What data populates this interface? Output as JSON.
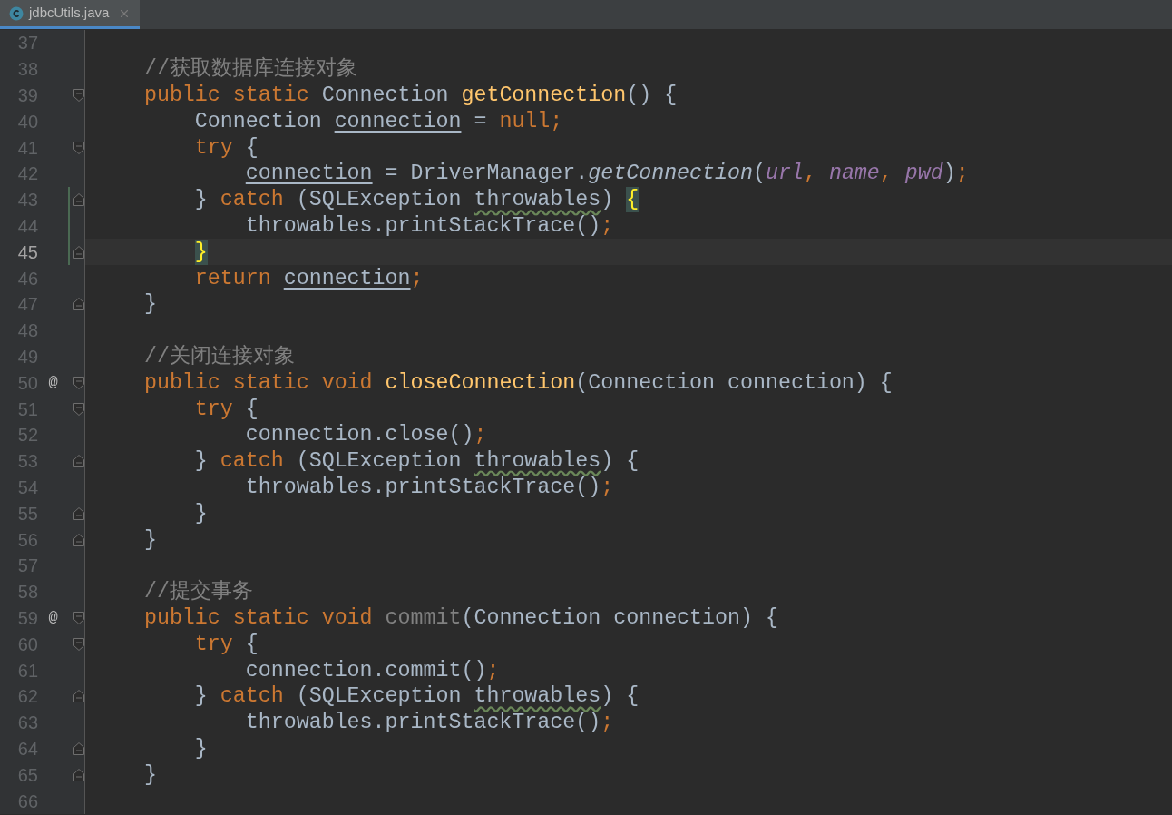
{
  "tabs": [
    {
      "label": "jdbcUtils.java",
      "selected": true
    }
  ],
  "lines": [
    {
      "number": "37",
      "current": false,
      "fold_start": false,
      "fold_end": false,
      "scope": false
    },
    {
      "number": "38",
      "current": false,
      "fold_start": false,
      "fold_end": false,
      "scope": false,
      "tokens": [
        {
          "kind": "comment",
          "text": "    //获取数据库连接对象"
        }
      ]
    },
    {
      "number": "39",
      "current": false,
      "fold_start": true,
      "fold_end": false,
      "scope": false,
      "tokens": [
        {
          "kind": "kw",
          "text": "    public static "
        },
        {
          "kind": "plain",
          "text": "Connection "
        },
        {
          "kind": "method",
          "text": "getConnection"
        },
        {
          "kind": "plain",
          "text": "() {"
        }
      ]
    },
    {
      "number": "40",
      "current": false,
      "fold_start": false,
      "fold_end": false,
      "scope": false,
      "tokens": [
        {
          "kind": "plain",
          "text": "        Connection "
        },
        {
          "kind": "var",
          "text": "connection"
        },
        {
          "kind": "plain",
          "text": " = "
        },
        {
          "kind": "kw",
          "text": "null;"
        }
      ]
    },
    {
      "number": "41",
      "current": false,
      "fold_start": true,
      "fold_end": false,
      "scope": false,
      "tokens": [
        {
          "kind": "kw",
          "text": "        try "
        },
        {
          "kind": "plain",
          "text": "{"
        }
      ]
    },
    {
      "number": "42",
      "current": false,
      "fold_start": false,
      "fold_end": false,
      "scope": false,
      "tokens": [
        {
          "kind": "var",
          "text": "            connection"
        },
        {
          "kind": "plain",
          "text": " = DriverManager."
        },
        {
          "kind": "italic",
          "text": "getConnection"
        },
        {
          "kind": "plain",
          "text": "("
        },
        {
          "kind": "field",
          "text": "url"
        },
        {
          "kind": "kw",
          "text": ", "
        },
        {
          "kind": "field",
          "text": "name"
        },
        {
          "kind": "kw",
          "text": ", "
        },
        {
          "kind": "field",
          "text": "pwd"
        },
        {
          "kind": "plain",
          "text": ")"
        },
        {
          "kind": "kw",
          "text": ";"
        }
      ]
    },
    {
      "number": "43",
      "current": false,
      "fold_start": false,
      "fold_end": true,
      "scope": true,
      "tokens": [
        {
          "kind": "plain",
          "text": "        } "
        },
        {
          "kind": "kw",
          "text": "catch "
        },
        {
          "kind": "plain",
          "text": "(SQLException "
        },
        {
          "kind": "typo",
          "text": "throwables"
        },
        {
          "kind": "plain",
          "text": ") "
        },
        {
          "kind": "brace",
          "text": "{"
        }
      ]
    },
    {
      "number": "44",
      "current": false,
      "fold_start": false,
      "fold_end": false,
      "scope": true,
      "tokens": [
        {
          "kind": "plain",
          "text": "            throwables.printStackTrace()"
        },
        {
          "kind": "kw",
          "text": ";"
        }
      ]
    },
    {
      "number": "45",
      "current": true,
      "fold_start": false,
      "fold_end": true,
      "scope": true,
      "tokens": [
        {
          "kind": "brace",
          "text": "        }"
        }
      ]
    },
    {
      "number": "46",
      "current": false,
      "fold_start": false,
      "fold_end": false,
      "scope": false,
      "tokens": [
        {
          "kind": "kw",
          "text": "        return "
        },
        {
          "kind": "var",
          "text": "connection"
        },
        {
          "kind": "kw",
          "text": ";"
        }
      ]
    },
    {
      "number": "47",
      "current": false,
      "fold_start": false,
      "fold_end": true,
      "scope": false,
      "tokens": [
        {
          "kind": "plain",
          "text": "    }"
        }
      ]
    },
    {
      "number": "48",
      "current": false,
      "fold_start": false,
      "fold_end": false,
      "scope": false
    },
    {
      "number": "49",
      "current": false,
      "fold_start": false,
      "fold_end": false,
      "scope": false,
      "tokens": [
        {
          "kind": "comment",
          "text": "    //关闭连接对象"
        }
      ]
    },
    {
      "number": "50",
      "current": false,
      "marker": "@",
      "fold_start": true,
      "fold_end": false,
      "scope": false,
      "tokens": [
        {
          "kind": "kw",
          "text": "    public static void "
        },
        {
          "kind": "method",
          "text": "closeConnection"
        },
        {
          "kind": "plain",
          "text": "(Connection connection) {"
        }
      ]
    },
    {
      "number": "51",
      "current": false,
      "fold_start": true,
      "fold_end": false,
      "scope": false,
      "tokens": [
        {
          "kind": "kw",
          "text": "        try "
        },
        {
          "kind": "plain",
          "text": "{"
        }
      ]
    },
    {
      "number": "52",
      "current": false,
      "fold_start": false,
      "fold_end": false,
      "scope": false,
      "tokens": [
        {
          "kind": "plain",
          "text": "            connection.close()"
        },
        {
          "kind": "kw",
          "text": ";"
        }
      ]
    },
    {
      "number": "53",
      "current": false,
      "fold_start": false,
      "fold_end": true,
      "scope": false,
      "tokens": [
        {
          "kind": "plain",
          "text": "        } "
        },
        {
          "kind": "kw",
          "text": "catch "
        },
        {
          "kind": "plain",
          "text": "(SQLException "
        },
        {
          "kind": "typo",
          "text": "throwables"
        },
        {
          "kind": "plain",
          "text": ") {"
        }
      ]
    },
    {
      "number": "54",
      "current": false,
      "fold_start": false,
      "fold_end": false,
      "scope": false,
      "tokens": [
        {
          "kind": "plain",
          "text": "            throwables.printStackTrace()"
        },
        {
          "kind": "kw",
          "text": ";"
        }
      ]
    },
    {
      "number": "55",
      "current": false,
      "fold_start": false,
      "fold_end": true,
      "scope": false,
      "tokens": [
        {
          "kind": "plain",
          "text": "        }"
        }
      ]
    },
    {
      "number": "56",
      "current": false,
      "fold_start": false,
      "fold_end": true,
      "scope": false,
      "tokens": [
        {
          "kind": "plain",
          "text": "    }"
        }
      ]
    },
    {
      "number": "57",
      "current": false,
      "fold_start": false,
      "fold_end": false,
      "scope": false
    },
    {
      "number": "58",
      "current": false,
      "fold_start": false,
      "fold_end": false,
      "scope": false,
      "tokens": [
        {
          "kind": "comment",
          "text": "    //提交事务"
        }
      ]
    },
    {
      "number": "59",
      "current": false,
      "marker": "@",
      "fold_start": true,
      "fold_end": false,
      "scope": false,
      "tokens": [
        {
          "kind": "kw",
          "text": "    public static void "
        },
        {
          "kind": "unused",
          "text": "commit"
        },
        {
          "kind": "plain",
          "text": "(Connection connection) {"
        }
      ]
    },
    {
      "number": "60",
      "current": false,
      "fold_start": true,
      "fold_end": false,
      "scope": false,
      "tokens": [
        {
          "kind": "kw",
          "text": "        try "
        },
        {
          "kind": "plain",
          "text": "{"
        }
      ]
    },
    {
      "number": "61",
      "current": false,
      "fold_start": false,
      "fold_end": false,
      "scope": false,
      "tokens": [
        {
          "kind": "plain",
          "text": "            connection.commit()"
        },
        {
          "kind": "kw",
          "text": ";"
        }
      ]
    },
    {
      "number": "62",
      "current": false,
      "fold_start": false,
      "fold_end": true,
      "scope": false,
      "tokens": [
        {
          "kind": "plain",
          "text": "        } "
        },
        {
          "kind": "kw",
          "text": "catch "
        },
        {
          "kind": "plain",
          "text": "(SQLException "
        },
        {
          "kind": "typo",
          "text": "throwables"
        },
        {
          "kind": "plain",
          "text": ") {"
        }
      ]
    },
    {
      "number": "63",
      "current": false,
      "fold_start": false,
      "fold_end": false,
      "scope": false,
      "tokens": [
        {
          "kind": "plain",
          "text": "            throwables.printStackTrace()"
        },
        {
          "kind": "kw",
          "text": ";"
        }
      ]
    },
    {
      "number": "64",
      "current": false,
      "fold_start": false,
      "fold_end": true,
      "scope": false,
      "tokens": [
        {
          "kind": "plain",
          "text": "        }"
        }
      ]
    },
    {
      "number": "65",
      "current": false,
      "fold_start": false,
      "fold_end": true,
      "scope": false,
      "tokens": [
        {
          "kind": "plain",
          "text": "    }"
        }
      ]
    },
    {
      "number": "66",
      "current": false,
      "fold_start": false,
      "fold_end": false,
      "scope": false
    }
  ]
}
